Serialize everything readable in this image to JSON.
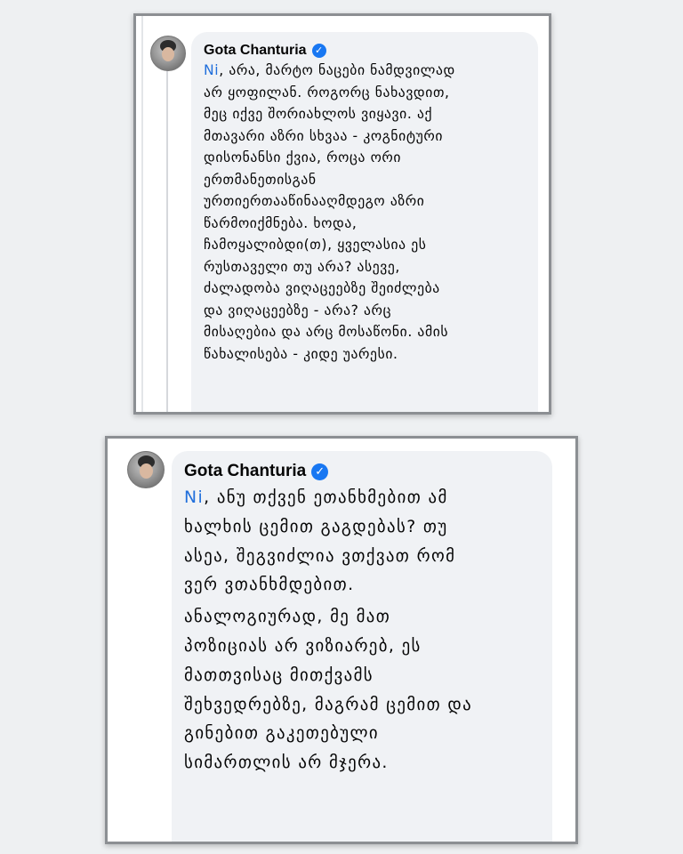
{
  "screenshot_1": {
    "author": "Gota Chanturia",
    "verified_icon": "verified-check-icon",
    "mention": "Ni",
    "comment": ", არა, მარტო ნაცები ნამდვილად\nარ ყოფილან. როგორც ნახავდით,\nმეც იქვე შორიახლოს ვიყავი. აქ\nმთავარი აზრი სხვაა - კოგნიტური\nდისონანსი ქვია, როცა ორი\nერთმანეთისგან\nურთიერთააწინააღმდეგო აზრი\nწარმოიქმნება. ხოდა,\nჩამოყალიბდი(თ), ყველასია ეს\nრუსთაველი თუ არა? ასევე,\nძალადობა ვიღაცეებზე შეიძლება\nდა ვიღაცეებზე - არა? არც\nმისაღებია და არც მოსაწონი. ამის\nწახალისება - კიდე უარესი."
  },
  "screenshot_2": {
    "author": "Gota Chanturia",
    "verified_icon": "verified-check-icon",
    "mention": "Ni",
    "comment_p1": ", ანუ თქვენ ეთანხმებით ამ\nხალხის ცემით გაგდებას? თუ\nასეა, შეგვიძლია ვთქვათ რომ\nვერ ვთანხმდებით.",
    "comment_p2": "ანალოგიურად, მე მათ\nპოზიციას არ ვიზიარებ, ეს\nმათთვისაც მითქვამს\nშეხვედრებზე, მაგრამ ცემით და\nგინებით გაკეთებული\nსიმართლის არ მჯერა."
  },
  "colors": {
    "mention": "#216fdb",
    "verified": "#1877f2",
    "bubble": "#f0f2f5",
    "frame": "#8c8f93",
    "background": "#eef0f2"
  }
}
